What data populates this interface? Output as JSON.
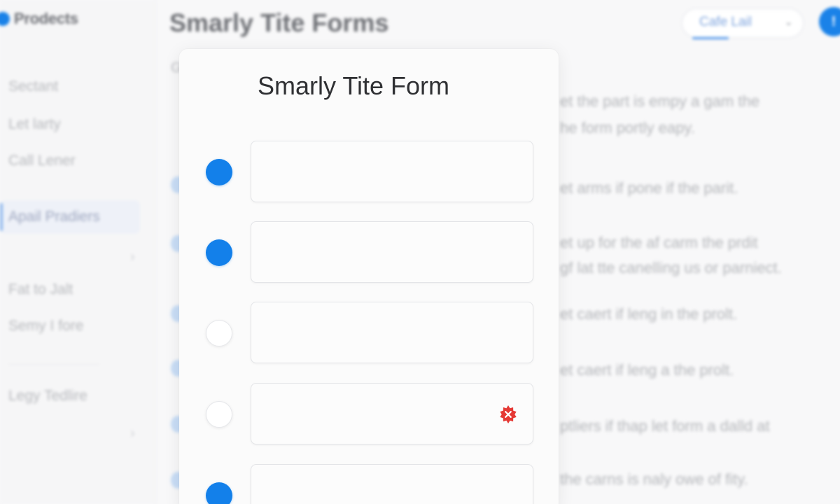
{
  "sidebar": {
    "brand": "Prodects",
    "items": [
      {
        "label": "Sectant"
      },
      {
        "label": "Let larty"
      },
      {
        "label": "Call Lener"
      },
      {
        "label": "Apail Pradiers",
        "active": true
      },
      {
        "label": "Fat to Jalt"
      },
      {
        "label": "Semy I fore"
      },
      {
        "label": "Legy Tedlire"
      }
    ]
  },
  "header": {
    "title": "Smarly Tite Forms",
    "select_value": "Cafe Lail",
    "user_initial": "!"
  },
  "background_content": {
    "stub": "G",
    "lines": [
      "et the part is empy a gam the",
      "he form portly eapy.",
      "et arms if pone if the parit.",
      "et up for the af carm the prdit",
      "gf lat tte canelling us or parniect.",
      "et caert if leng in the prolt.",
      "et caert if leng a the prolt.",
      "ptliers if thap let form a dalld at",
      "the carns is naly owe of fity."
    ]
  },
  "modal": {
    "title": "Smarly Tite Form",
    "fields": [
      {
        "selected": true,
        "value": "",
        "error": false
      },
      {
        "selected": true,
        "value": "",
        "error": false
      },
      {
        "selected": false,
        "value": "",
        "error": false
      },
      {
        "selected": false,
        "value": "",
        "error": true
      },
      {
        "selected": true,
        "value": "",
        "error": false
      }
    ]
  },
  "colors": {
    "accent": "#1380ea",
    "error": "#e53935",
    "modal_bg": "#fbfbfb"
  },
  "icons": {
    "radio_on": "filled-circle",
    "radio_off": "empty-circle",
    "error": "error-badge-icon",
    "select_chevron": "chevron-down-icon",
    "nav_chevron": "chevron-right-icon"
  }
}
